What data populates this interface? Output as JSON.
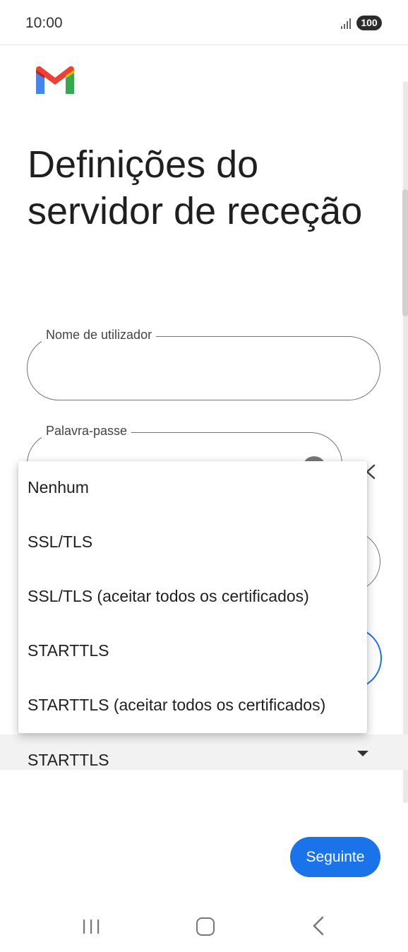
{
  "status_bar": {
    "time": "10:00",
    "battery": "100"
  },
  "page": {
    "title": "Definições do servidor de receção"
  },
  "form": {
    "username_label": "Nome de utilizador",
    "password_label": "Palavra-passe"
  },
  "security_dropdown": {
    "options": [
      "Nenhum",
      "SSL/TLS",
      "SSL/TLS (aceitar todos os certificados)",
      "STARTTLS",
      "STARTTLS (aceitar todos os certificados)"
    ],
    "selected": "STARTTLS"
  },
  "actions": {
    "next_label": "Seguinte"
  },
  "colors": {
    "accent": "#1a73e8",
    "gmail_red": "#ea4335",
    "gmail_blue": "#4285f4",
    "gmail_green": "#34a853",
    "gmail_yellow": "#fbbc04"
  },
  "icons": [
    "signal-icon",
    "gmail-logo",
    "visibility-icon",
    "back-chevron-icon",
    "dropdown-arrow-icon",
    "nav-recent-icon",
    "nav-home-icon",
    "nav-back-icon"
  ]
}
